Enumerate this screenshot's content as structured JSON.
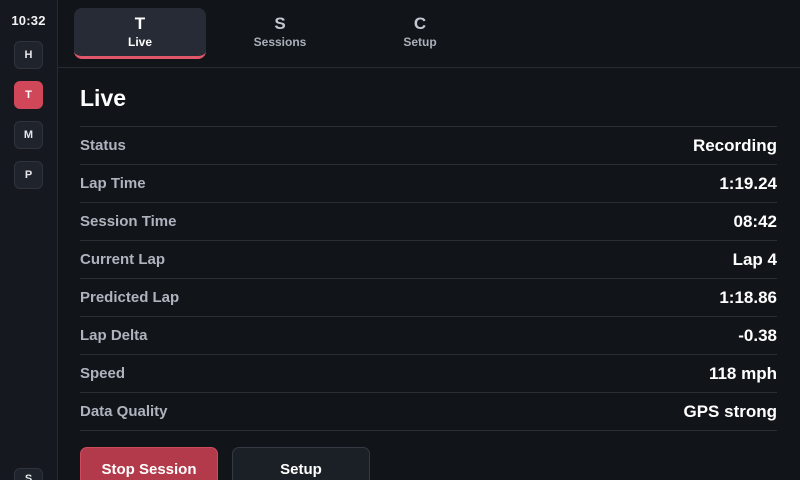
{
  "clock": "10:32",
  "rail": {
    "items": [
      {
        "label": "H",
        "active": false
      },
      {
        "label": "T",
        "active": true
      },
      {
        "label": "M",
        "active": false
      },
      {
        "label": "P",
        "active": false
      }
    ],
    "bottom_label": "S"
  },
  "tabs": [
    {
      "icon": "T",
      "label": "Live",
      "active": true
    },
    {
      "icon": "S",
      "label": "Sessions",
      "active": false
    },
    {
      "icon": "C",
      "label": "Setup",
      "active": false
    }
  ],
  "page": {
    "title": "Live",
    "rows": [
      {
        "label": "Status",
        "value": "Recording"
      },
      {
        "label": "Lap Time",
        "value": "1:19.24"
      },
      {
        "label": "Session Time",
        "value": "08:42"
      },
      {
        "label": "Current Lap",
        "value": "Lap 4"
      },
      {
        "label": "Predicted Lap",
        "value": "1:18.86"
      },
      {
        "label": "Lap Delta",
        "value": "-0.38"
      },
      {
        "label": "Speed",
        "value": "118 mph"
      },
      {
        "label": "Data Quality",
        "value": "GPS strong"
      }
    ]
  },
  "actions": {
    "stop_label": "Stop Session",
    "setup_label": "Setup"
  },
  "colors": {
    "accent": "#d0475a",
    "background": "#111419",
    "rail": "#15181e"
  }
}
